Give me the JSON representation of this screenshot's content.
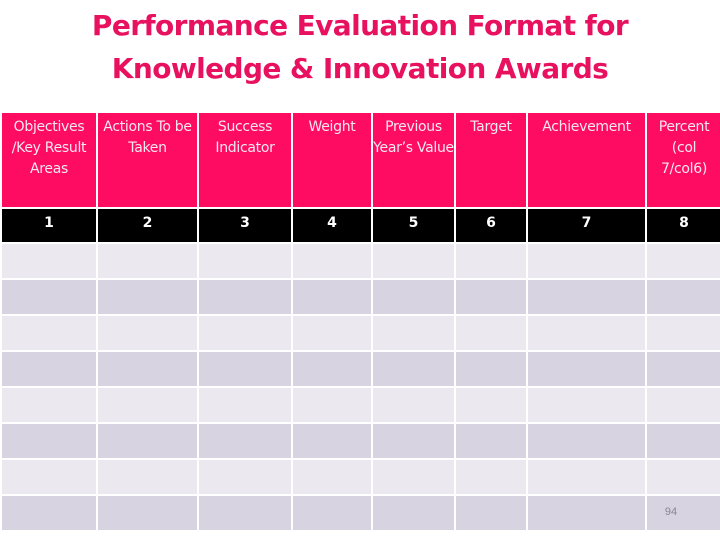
{
  "slide": {
    "title_lines": [
      "Performance Evaluation Format for",
      "Knowledge & Innovation Awards"
    ],
    "page_number": "94"
  },
  "colors": {
    "title": "#e8115f",
    "header_bg": "#fe0b62",
    "header_text": "#f6e8f1",
    "number_row_bg": "#000000",
    "row_light": "#ebe9ef",
    "row_dark": "#d7d3e0"
  },
  "table": {
    "headers": [
      "Objectives /Key Result Areas",
      "Actions To be Taken",
      "Success Indicator",
      "Weight",
      "Previous Year’s Value",
      "Target",
      "Achievement",
      "Percent (col 7/col6)"
    ],
    "column_numbers": [
      "1",
      "2",
      "3",
      "4",
      "5",
      "6",
      "7",
      "8"
    ],
    "rows": [
      [
        "",
        "",
        "",
        "",
        "",
        "",
        "",
        ""
      ],
      [
        "",
        "",
        "",
        "",
        "",
        "",
        "",
        ""
      ],
      [
        "",
        "",
        "",
        "",
        "",
        "",
        "",
        ""
      ],
      [
        "",
        "",
        "",
        "",
        "",
        "",
        "",
        ""
      ],
      [
        "",
        "",
        "",
        "",
        "",
        "",
        "",
        ""
      ],
      [
        "",
        "",
        "",
        "",
        "",
        "",
        "",
        ""
      ],
      [
        "",
        "",
        "",
        "",
        "",
        "",
        "",
        ""
      ],
      [
        "",
        "",
        "",
        "",
        "",
        "",
        "",
        ""
      ]
    ]
  }
}
